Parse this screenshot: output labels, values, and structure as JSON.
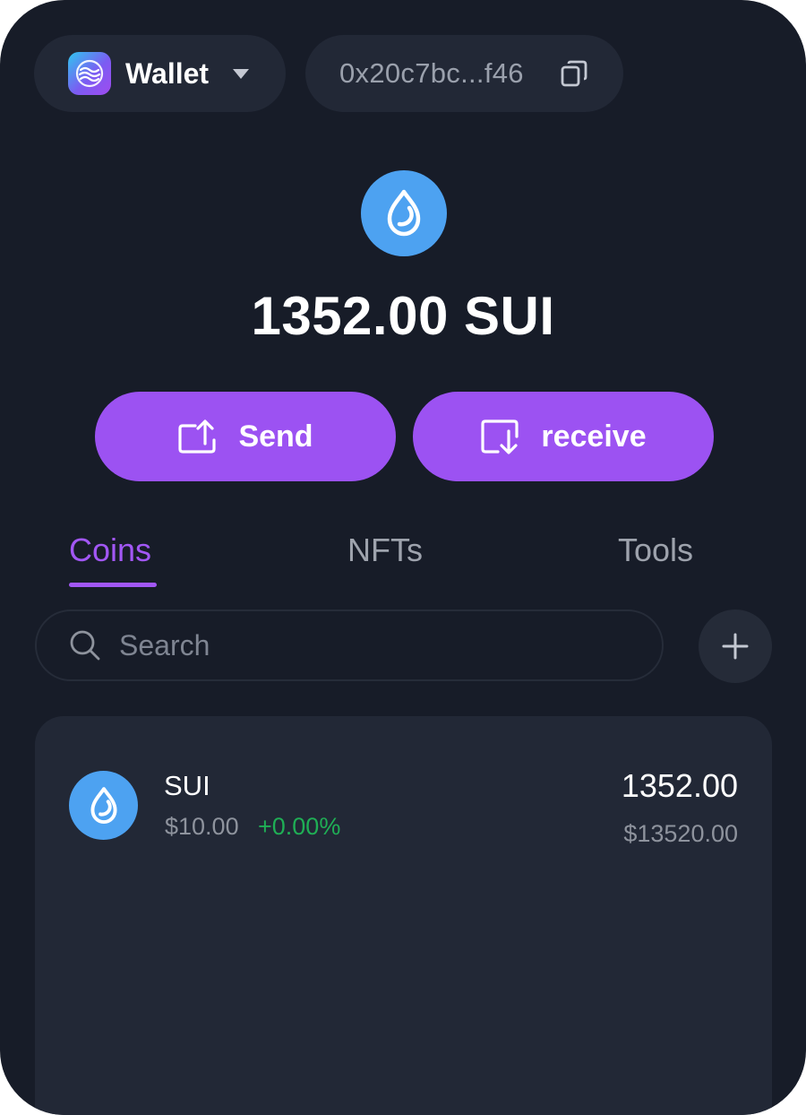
{
  "header": {
    "wallet_name": "Wallet",
    "address": "0x20c7bc...f46"
  },
  "balance": {
    "amount": "1352.00",
    "symbol": "SUI",
    "display": "1352.00 SUI"
  },
  "actions": {
    "send_label": "Send",
    "receive_label": "receive"
  },
  "tabs": [
    {
      "label": "Coins",
      "active": true
    },
    {
      "label": "NFTs",
      "active": false
    },
    {
      "label": "Tools",
      "active": false
    }
  ],
  "search": {
    "placeholder": "Search",
    "value": ""
  },
  "coins": [
    {
      "symbol": "SUI",
      "price": "$10.00",
      "change": "+0.00%",
      "amount": "1352.00",
      "value": "$13520.00",
      "icon": "sui-droplet-icon"
    }
  ],
  "colors": {
    "background": "#171c28",
    "surface": "#222836",
    "accent": "#9c52f2",
    "token_blue": "#4da2f1",
    "positive": "#1fae55"
  }
}
